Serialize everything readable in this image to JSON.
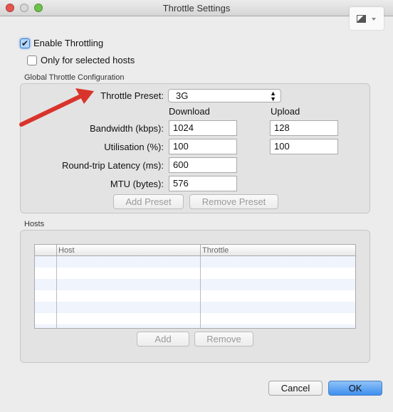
{
  "window": {
    "title": "Throttle Settings"
  },
  "toolbar": {
    "picture_icon": "image-icon",
    "menu_icon": "chevron-down-icon"
  },
  "options": {
    "enable_throttling": {
      "label": "Enable Throttling",
      "checked": true
    },
    "only_selected_hosts": {
      "label": "Only for selected hosts",
      "checked": false
    }
  },
  "global": {
    "title": "Global Throttle Configuration",
    "preset_label": "Throttle Preset:",
    "preset_value": "3G",
    "download_header": "Download",
    "upload_header": "Upload",
    "bandwidth_label": "Bandwidth (kbps):",
    "bandwidth_down": "1024",
    "bandwidth_up": "128",
    "utilisation_label": "Utilisation (%):",
    "utilisation_down": "100",
    "utilisation_up": "100",
    "latency_label": "Round-trip Latency (ms):",
    "latency": "600",
    "mtu_label": "MTU (bytes):",
    "mtu": "576",
    "add_preset": "Add Preset",
    "remove_preset": "Remove Preset"
  },
  "hosts": {
    "title": "Hosts",
    "columns": [
      "",
      "Host",
      "Throttle"
    ],
    "add": "Add",
    "remove": "Remove"
  },
  "footer": {
    "cancel": "Cancel",
    "ok": "OK"
  },
  "annotation": {
    "arrow_color": "#d9342b"
  }
}
